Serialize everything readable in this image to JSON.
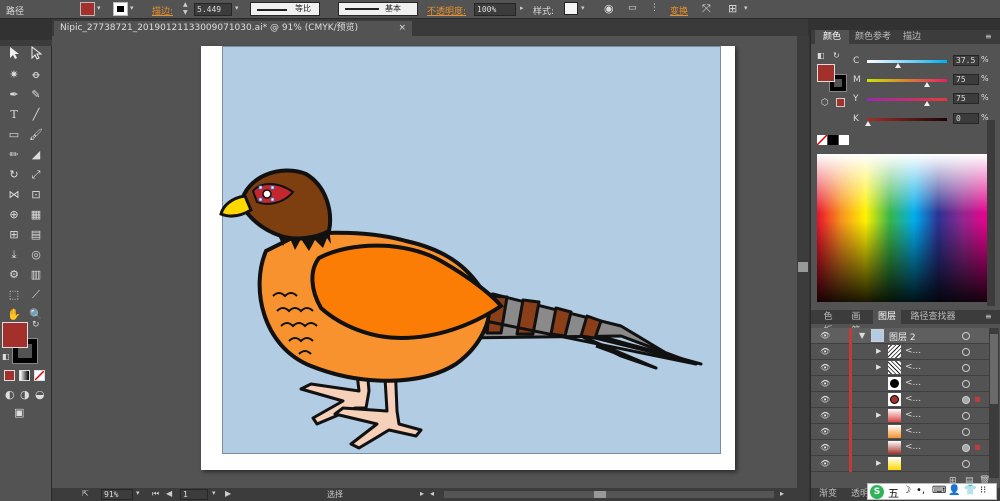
{
  "control_bar": {
    "path_label": "路径",
    "stroke_link": "描边:",
    "stroke_value": "5.449",
    "stroke_profile": "等比",
    "brush_def": "基本",
    "opacity_link": "不透明度:",
    "opacity_value": "100%",
    "style_label": "样式:",
    "transform_link": "变换"
  },
  "document": {
    "tab_title": "Nipic_27738721_20190121133009071030.ai* @ 91% (CMYK/预览)",
    "close_symbol": "×"
  },
  "colors": {
    "fill": "#a3302b",
    "artboard_bg": "#b1cce3",
    "body_orange": "#f7922e",
    "wing_orange": "#fb7d06",
    "head_brown": "#7e3f10",
    "beak_yellow": "#ffd800",
    "tail_brown": "#8b3f18",
    "tail_gray": "#8a8a8a",
    "feet_pink": "#f6d0b8"
  },
  "color_panel": {
    "tabs": [
      "颜色",
      "颜色参考",
      "描边"
    ],
    "channels": [
      {
        "key": "C",
        "value": "37.5",
        "pct": 0.375
      },
      {
        "key": "M",
        "value": "75",
        "pct": 0.75
      },
      {
        "key": "Y",
        "value": "75",
        "pct": 0.75
      },
      {
        "key": "K",
        "value": "0",
        "pct": 0.0
      }
    ]
  },
  "layers_panel": {
    "tabs": [
      "色板",
      "画笔",
      "图层",
      "路径查找器"
    ],
    "top_layer_name": "图层 2",
    "sublayer_names": [
      "<...",
      "<...",
      "<...",
      "<...",
      "<...",
      "<...",
      "<..."
    ]
  },
  "status_bar": {
    "zoom": "91%",
    "page": "1",
    "tool_name": "选择"
  },
  "bottom_panels": [
    "渐变",
    "透明"
  ],
  "ime": {
    "label": "五",
    "badge": "S"
  }
}
